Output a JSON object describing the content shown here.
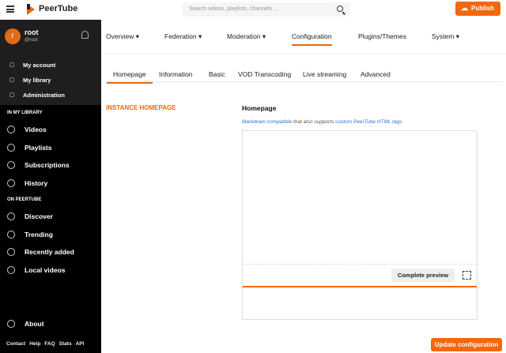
{
  "header": {
    "brand": "PeerTube",
    "search_placeholder": "Search videos, playlists, channels…",
    "publish": "Publish"
  },
  "user": {
    "initial": "r",
    "name": "root",
    "handle": "@root"
  },
  "user_menu": [
    "My account",
    "My library",
    "Administration"
  ],
  "sections": {
    "library": "IN MY LIBRARY",
    "peertube": "ON PEERTUBE"
  },
  "library_items": [
    "Videos",
    "Playlists",
    "Subscriptions",
    "History"
  ],
  "peertube_items": [
    "Discover",
    "Trending",
    "Recently added",
    "Local videos"
  ],
  "about": "About",
  "footer_links": [
    "Contact",
    "Help",
    "FAQ",
    "Stats",
    "API"
  ],
  "main_nav": [
    "Overview ▾",
    "Federation ▾",
    "Moderation ▾",
    "Configuration",
    "Plugins/Themes",
    "System ▾"
  ],
  "tabs": [
    "Homepage",
    "Information",
    "Basic",
    "VOD Transcoding",
    "Live streaming",
    "Advanced"
  ],
  "section_title": "INSTANCE HOMEPAGE",
  "field": {
    "label": "Homepage",
    "help_link1": "Markdown compatible",
    "help_mid": " that also supports ",
    "help_link2": "custom PeerTube HTML tags",
    "value": "",
    "preview_button": "Complete preview"
  },
  "update_button": "Update configuration",
  "colors": {
    "accent": "#f1680d",
    "sidebar": "#000000"
  }
}
